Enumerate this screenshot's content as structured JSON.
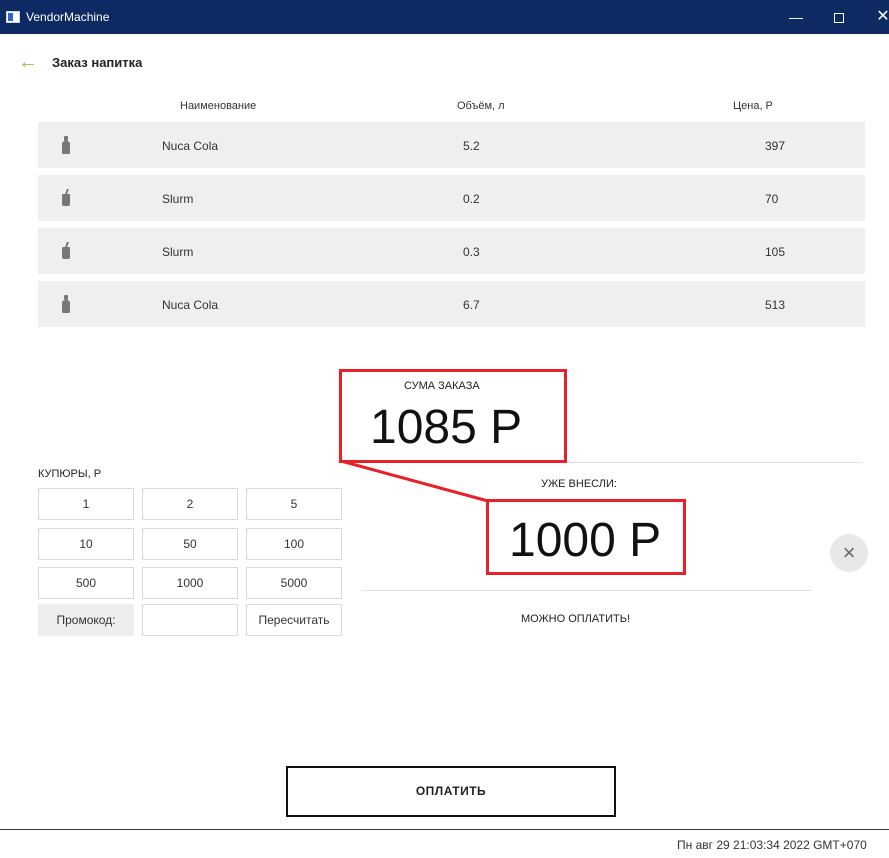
{
  "window": {
    "title": "VendorMachine",
    "minimize": "—",
    "close": "✕"
  },
  "header": {
    "title": "Заказ напитка"
  },
  "table": {
    "columns": [
      "Наименование",
      "Объём, л",
      "Цена, Р"
    ],
    "rows": [
      {
        "icon": "bottle-icon",
        "name": "Nuca Cola",
        "volume": "5.2",
        "price": "397"
      },
      {
        "icon": "cup-icon",
        "name": "Slurm",
        "volume": "0.2",
        "price": "70"
      },
      {
        "icon": "cup-icon",
        "name": "Slurm",
        "volume": "0.3",
        "price": "105"
      },
      {
        "icon": "bottle-icon",
        "name": "Nuca Cola",
        "volume": "6.7",
        "price": "513"
      }
    ]
  },
  "order": {
    "sum_label": "СУМА ЗАКАЗА",
    "sum_value": "1085 Р",
    "paid_label": "УЖЕ ВНЕСЛИ:",
    "paid_value": "1000 Р",
    "status": "МОЖНО ОПЛАТИТЬ!",
    "highlight_color": "#e8202a"
  },
  "bills": {
    "label": "КУПЮРЫ, Р",
    "values": [
      "1",
      "2",
      "5",
      "10",
      "50",
      "100",
      "500",
      "1000",
      "5000"
    ],
    "promo_label": "Промокод:",
    "promo_value": "",
    "recalc_label": "Пересчитать"
  },
  "actions": {
    "pay_label": "ОПЛАТИТЬ",
    "clear_icon": "close-icon"
  },
  "footer": {
    "datetime": "Пн авг 29 21:03:34 2022 GMT+070"
  },
  "colors": {
    "titlebar": "#0e2a63",
    "accent_back": "#8bc34a",
    "row_bg": "#efefef"
  }
}
